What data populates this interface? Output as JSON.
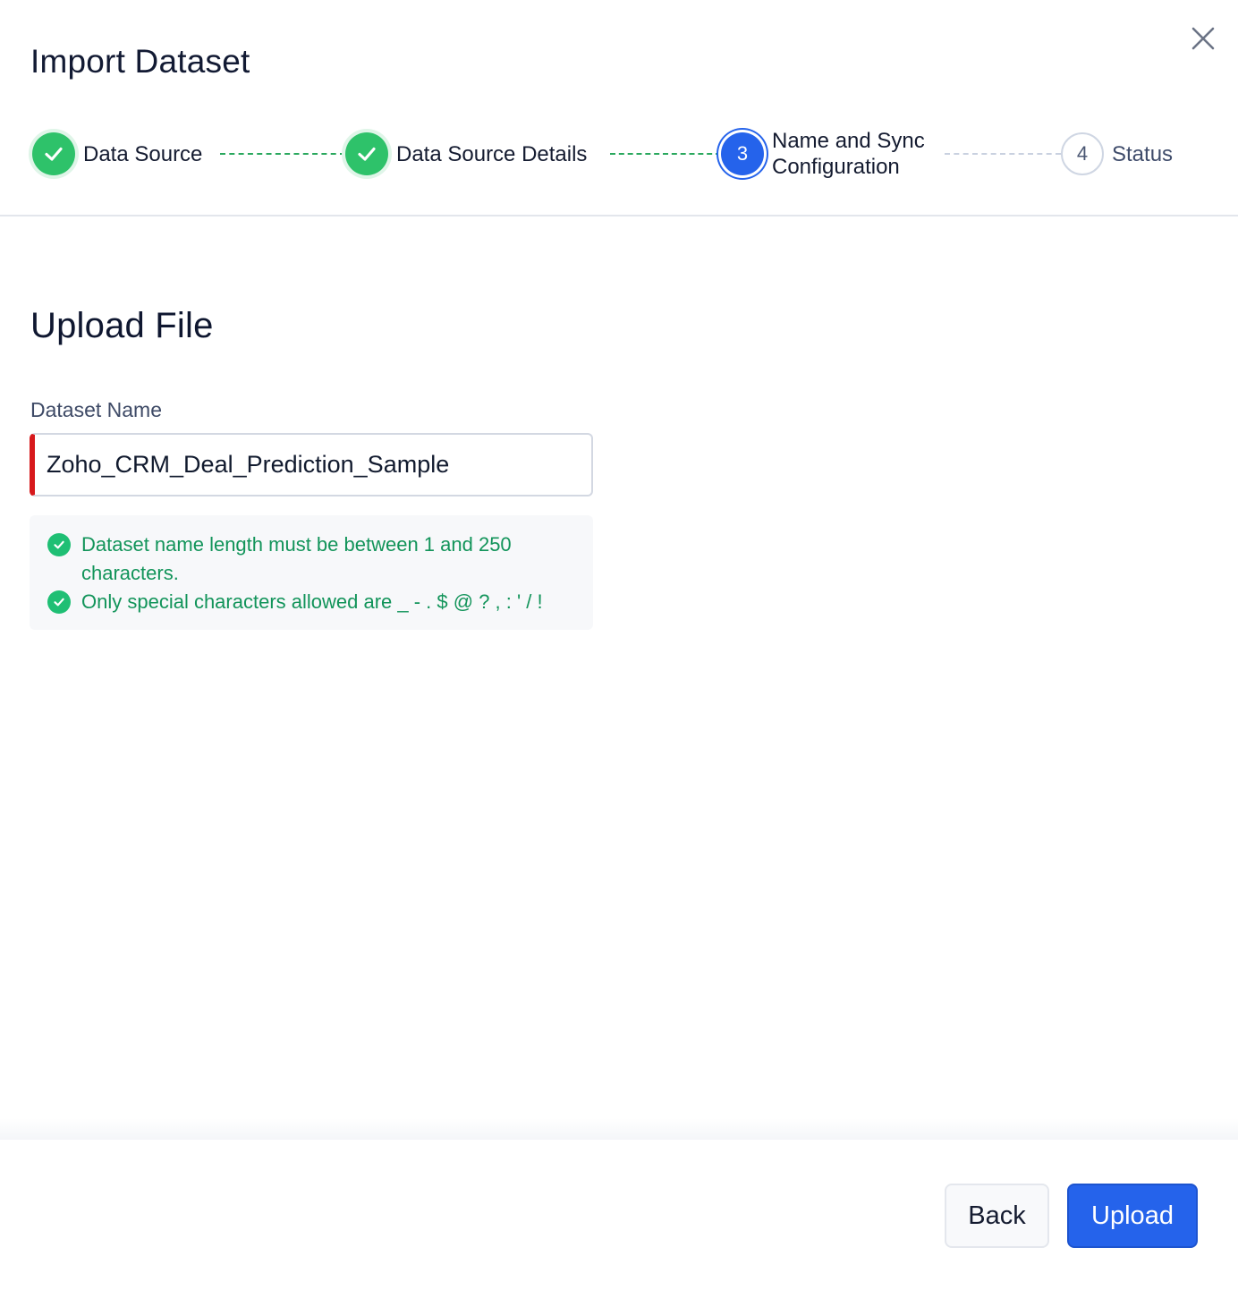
{
  "dialog": {
    "title": "Import Dataset",
    "close_icon": "close-icon"
  },
  "stepper": {
    "steps": [
      {
        "label": "Data Source",
        "state": "completed",
        "icon": "check-icon"
      },
      {
        "label": "Data Source Details",
        "state": "completed",
        "icon": "check-icon"
      },
      {
        "number": "3",
        "label_line1": "Name and Sync",
        "label_line2": "Configuration",
        "state": "active"
      },
      {
        "number": "4",
        "label": "Status",
        "state": "pending"
      }
    ]
  },
  "form": {
    "section_title": "Upload File",
    "dataset_name_label": "Dataset Name",
    "dataset_name_value": "Zoho_CRM_Deal_Prediction_Sample",
    "validation_rules": [
      {
        "text": "Dataset name length must be between 1 and 250 characters.",
        "icon": "check-circle-icon"
      },
      {
        "text": "Only special characters allowed are _ - . $ @ ? , : ' / !",
        "icon": "check-circle-icon"
      }
    ]
  },
  "footer": {
    "back_label": "Back",
    "upload_label": "Upload"
  },
  "colors": {
    "primary": "#2563eb",
    "success": "#2ec26a",
    "success_text": "#12945a",
    "error_border": "#d7191c"
  }
}
